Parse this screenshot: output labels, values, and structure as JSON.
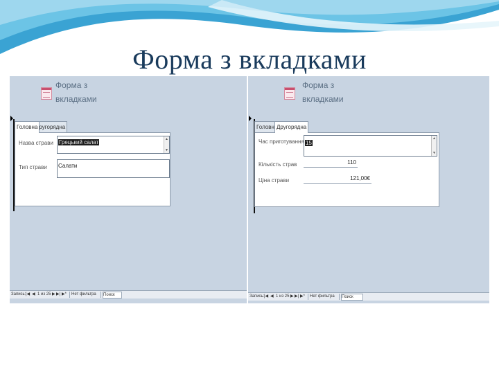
{
  "slide": {
    "title": "Форма з вкладками"
  },
  "forms": [
    {
      "form_name": "Форма з вкладками",
      "tabs": [
        "Головна",
        "Другорядна"
      ],
      "active_tab": 0,
      "fields": [
        {
          "label": "Назва страви",
          "value": "Грецький салат"
        },
        {
          "label": "Тип страви",
          "value": "Салати"
        }
      ],
      "navigation": {
        "prefix": "Запись:",
        "record": "1 из 25",
        "filter": "Нет фильтра",
        "search": "Поиск"
      }
    },
    {
      "form_name": "Форма з вкладками",
      "tabs": [
        "Головна",
        "Другорядна"
      ],
      "active_tab": 1,
      "fields": [
        {
          "label": "Час приготування",
          "value": "15"
        },
        {
          "label": "Кількість страв",
          "value": "110"
        },
        {
          "label": "Ціна страви",
          "value": "121,00€"
        }
      ],
      "navigation": {
        "prefix": "Запись:",
        "record": "1 из 25",
        "filter": "Нет фильтра",
        "search": "Поиск"
      }
    }
  ],
  "colors": {
    "title": "#1a3b5c",
    "swoosh": "#4fb3dd",
    "form_background": "#c8d4e2"
  },
  "icons": {
    "form": "form-icon",
    "record_selector": "record-selector-arrow",
    "nav_first": "first-record-icon",
    "nav_prev": "prev-record-icon",
    "nav_next": "next-record-icon",
    "nav_last": "last-record-icon",
    "nav_new": "new-record-icon"
  }
}
